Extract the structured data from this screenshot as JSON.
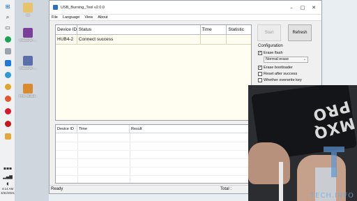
{
  "window": {
    "title": "USB_Burning_Tool v2.0.0",
    "menu": [
      "File",
      "Language",
      "View",
      "About"
    ]
  },
  "device_table": {
    "columns": [
      "Device ID",
      "Status",
      "Time",
      "Statistic"
    ],
    "rows": [
      {
        "device_id": "HUB4-2",
        "status": "Connect success",
        "time": "",
        "statistic": ""
      }
    ]
  },
  "log_table": {
    "columns": [
      "Device ID",
      "Time",
      "Result"
    ]
  },
  "buttons": {
    "start": "Start",
    "refresh": "Refresh"
  },
  "configuration": {
    "title": "Configuration",
    "erase_flash": {
      "label": "Erase flash",
      "checked": true
    },
    "erase_mode": "Normal erase",
    "erase_bootloader": {
      "label": "Erase bootloader",
      "checked": true
    },
    "reset_after_success": {
      "label": "Reset after success",
      "checked": false
    },
    "whether_overwrite_key": {
      "label": "Whether overwrite key",
      "checked": false
    }
  },
  "statusbar": {
    "state": "Ready",
    "total_label": "Total :"
  },
  "desktop": {
    "icons": [
      "W",
      "Andirogki_...",
      "Andirogki_...",
      "YYD_Buind..."
    ],
    "clock_time": "4:14 AM",
    "clock_date": "3/31/2021"
  },
  "overlay": {
    "device_brand": "MXQ PRO",
    "watermark": "TECH.INFO"
  },
  "colors": {
    "grid_yellow": "#fffef0",
    "window_bg": "#f0f0f0",
    "accent_blue": "#2d6fc0"
  }
}
